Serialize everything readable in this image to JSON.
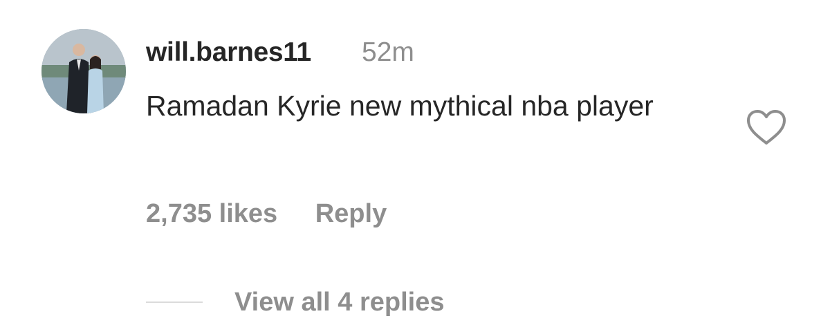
{
  "comment": {
    "avatar_icon": "user-avatar-photo",
    "username": "will.barnes11",
    "time": "52m",
    "text": "Ramadan Kyrie new mythical nba player",
    "likes": "2,735 likes",
    "reply_label": "Reply",
    "like_icon": "heart-outline-icon",
    "view_replies": "View all 4 replies"
  },
  "colors": {
    "primary_text": "#262626",
    "secondary_text": "#8e8e8e",
    "divider": "#dbdbdb"
  }
}
